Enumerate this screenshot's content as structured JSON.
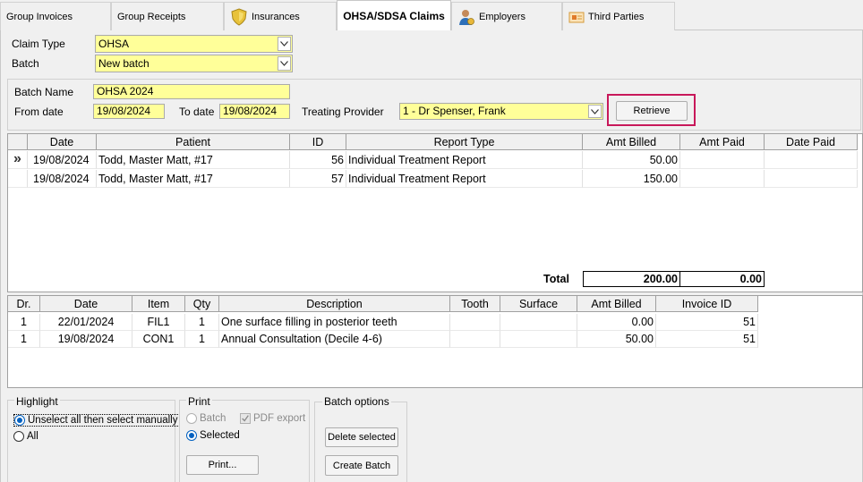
{
  "tabs": [
    {
      "label": "Group Invoices",
      "icon": ""
    },
    {
      "label": "Group Receipts",
      "icon": ""
    },
    {
      "label": "Insurances",
      "icon": "shield-icon"
    },
    {
      "label": "OHSA/SDSA Claims",
      "icon": ""
    },
    {
      "label": "Employers",
      "icon": "person-icon"
    },
    {
      "label": "Third Parties",
      "icon": "third-party-icon"
    }
  ],
  "top_form": {
    "claim_type_label": "Claim Type",
    "claim_type_value": "OHSA",
    "batch_label": "Batch",
    "batch_value": "New batch"
  },
  "batch_form": {
    "batch_name_label": "Batch Name",
    "batch_name_value": "OHSA 2024",
    "from_date_label": "From date",
    "from_date_value": "19/08/2024",
    "to_date_label": "To date",
    "to_date_value": "19/08/2024",
    "provider_label": "Treating Provider",
    "provider_value": "1 - Dr Spenser, Frank",
    "retrieve_label": "Retrieve"
  },
  "claims_grid": {
    "headers": [
      "Date",
      "Patient",
      "ID",
      "Report Type",
      "Amt Billed",
      "Amt Paid",
      "Date Paid"
    ],
    "current_row_marker": "»",
    "rows": [
      {
        "date": "19/08/2024",
        "patient": "Todd, Master Matt, #17",
        "id": "56",
        "report_type": "Individual Treatment Report",
        "amt_billed": "50.00",
        "amt_paid": "",
        "date_paid": ""
      },
      {
        "date": "19/08/2024",
        "patient": "Todd, Master Matt, #17",
        "id": "57",
        "report_type": "Individual Treatment Report",
        "amt_billed": "150.00",
        "amt_paid": "",
        "date_paid": ""
      }
    ],
    "total_label": "Total",
    "total_billed": "200.00",
    "total_paid": "0.00"
  },
  "items_grid": {
    "headers": [
      "Dr.",
      "Date",
      "Item",
      "Qty",
      "Description",
      "Tooth",
      "Surface",
      "Amt Billed",
      "Invoice ID"
    ],
    "rows": [
      {
        "dr": "1",
        "date": "22/01/2024",
        "item": "FIL1",
        "qty": "1",
        "description": "One surface filling in posterior teeth",
        "tooth": "",
        "surface": "",
        "amt_billed": "0.00",
        "invoice_id": "51"
      },
      {
        "dr": "1",
        "date": "19/08/2024",
        "item": "CON1",
        "qty": "1",
        "description": "Annual Consultation (Decile 4-6)",
        "tooth": "",
        "surface": "",
        "amt_billed": "50.00",
        "invoice_id": "51"
      }
    ]
  },
  "highlight": {
    "title": "Highlight",
    "opt_manual": "Unselect all then select manually",
    "opt_all": "All"
  },
  "print": {
    "title": "Print",
    "opt_batch": "Batch",
    "opt_pdf": "PDF export",
    "opt_selected": "Selected",
    "print_button": "Print..."
  },
  "batch_options": {
    "title": "Batch options",
    "delete_button": "Delete selected",
    "create_button": "Create Batch"
  },
  "colors": {
    "field_yellow": "#ffff99",
    "highlight_border": "#c8185a"
  }
}
